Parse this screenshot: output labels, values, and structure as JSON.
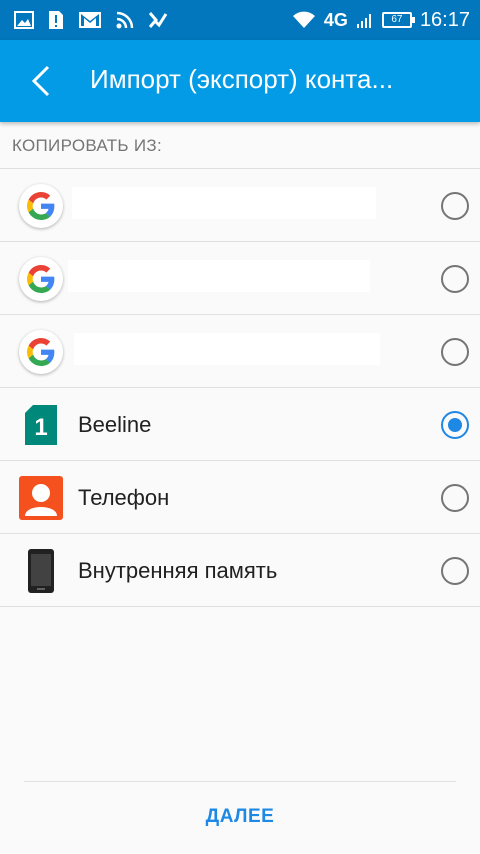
{
  "status_bar": {
    "network": "4G",
    "battery": "67",
    "time": "16:17"
  },
  "app_bar": {
    "title": "Импорт (экспорт) конта..."
  },
  "section_header": "КОПИРОВАТЬ ИЗ:",
  "accounts": [
    {
      "type": "google",
      "label": "",
      "selected": false
    },
    {
      "type": "google",
      "label": "",
      "selected": false
    },
    {
      "type": "google",
      "label": "",
      "selected": false
    },
    {
      "type": "sim",
      "label": "Beeline",
      "sim_number": "1",
      "selected": true
    },
    {
      "type": "phone",
      "label": "Телефон",
      "selected": false
    },
    {
      "type": "internal",
      "label": "Внутренняя память",
      "selected": false
    }
  ],
  "footer": {
    "next_label": "ДАЛЕЕ"
  },
  "colors": {
    "status_bar": "#0277bd",
    "app_bar": "#039be5",
    "accent": "#1e88e5",
    "sim": "#00897b",
    "phone": "#f4511e"
  }
}
